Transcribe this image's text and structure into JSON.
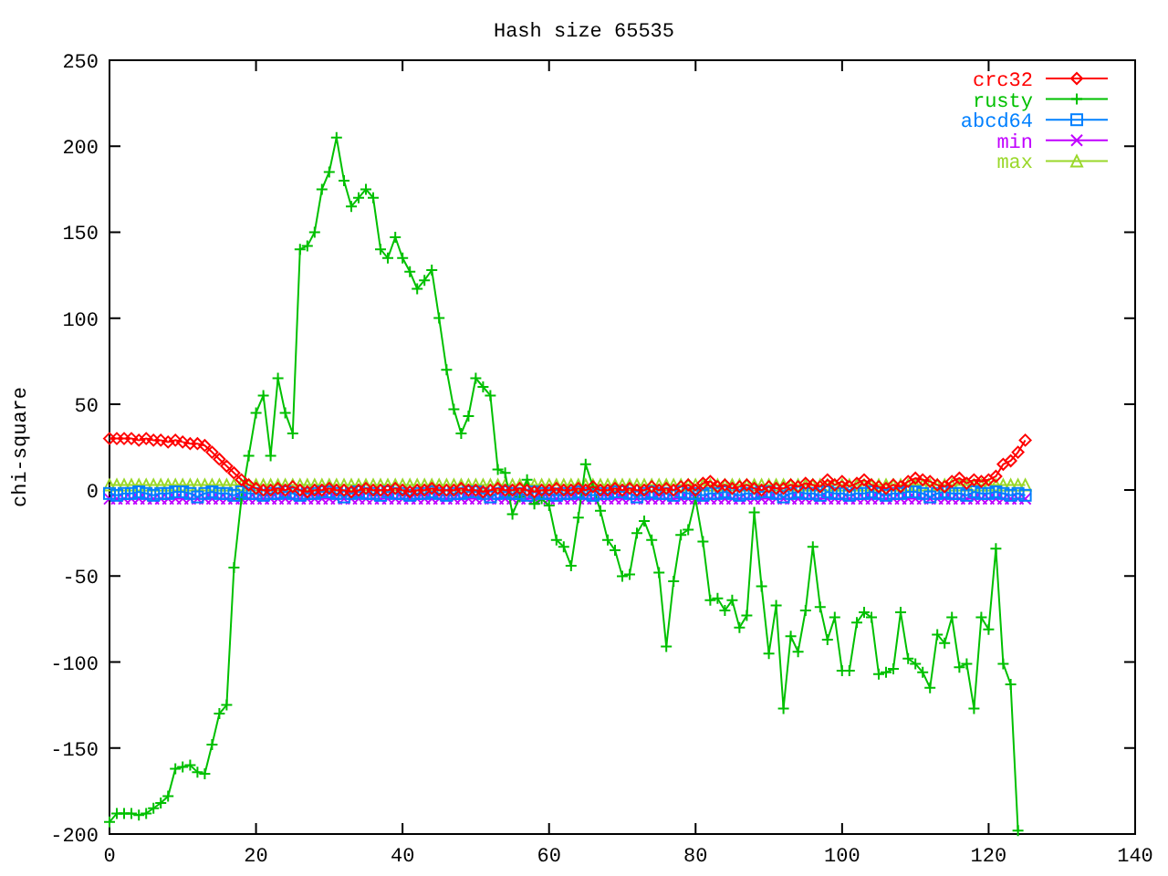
{
  "chart_data": {
    "type": "line",
    "title": "Hash size 65535",
    "ylabel": "chi-square",
    "x": [
      0,
      1,
      2,
      3,
      4,
      5,
      6,
      7,
      8,
      9,
      10,
      11,
      12,
      13,
      14,
      15,
      16,
      17,
      18,
      19,
      20,
      21,
      22,
      23,
      24,
      25,
      26,
      27,
      28,
      29,
      30,
      31,
      32,
      33,
      34,
      35,
      36,
      37,
      38,
      39,
      40,
      41,
      42,
      43,
      44,
      45,
      46,
      47,
      48,
      49,
      50,
      51,
      52,
      53,
      54,
      55,
      56,
      57,
      58,
      59,
      60,
      61,
      62,
      63,
      64,
      65,
      66,
      67,
      68,
      69,
      70,
      71,
      72,
      73,
      74,
      75,
      76,
      77,
      78,
      79,
      80,
      81,
      82,
      83,
      84,
      85,
      86,
      87,
      88,
      89,
      90,
      91,
      92,
      93,
      94,
      95,
      96,
      97,
      98,
      99,
      100,
      101,
      102,
      103,
      104,
      105,
      106,
      107,
      108,
      109,
      110,
      111,
      112,
      113,
      114,
      115,
      116,
      117,
      118,
      119,
      120,
      121,
      122,
      123,
      124,
      125
    ],
    "series": [
      {
        "name": "crc32",
        "color": "#ff0000",
        "marker": "diamond",
        "values": [
          30,
          30,
          30,
          30,
          29,
          30,
          29,
          29,
          28,
          29,
          28,
          27,
          27,
          26,
          22,
          18,
          14,
          10,
          6,
          3,
          1,
          0,
          0,
          1,
          0,
          2,
          0,
          -1,
          0,
          0,
          1,
          0,
          0,
          -1,
          0,
          1,
          0,
          0,
          0,
          1,
          0,
          -1,
          0,
          0,
          1,
          0,
          0,
          0,
          1,
          0,
          0,
          -1,
          0,
          1,
          0,
          0,
          1,
          0,
          -1,
          0,
          0,
          1,
          0,
          0,
          1,
          0,
          2,
          0,
          0,
          1,
          0,
          1,
          0,
          0,
          2,
          0,
          1,
          0,
          2,
          3,
          0,
          4,
          5,
          2,
          3,
          1,
          2,
          3,
          1,
          0,
          2,
          1,
          1,
          3,
          2,
          4,
          3,
          2,
          6,
          3,
          5,
          2,
          4,
          6,
          3,
          2,
          1,
          3,
          2,
          5,
          7,
          6,
          5,
          3,
          2,
          5,
          7,
          4,
          6,
          5,
          6,
          8,
          15,
          17,
          22,
          29
        ]
      },
      {
        "name": "rusty",
        "color": "#00c000",
        "marker": "plus",
        "values": [
          -193,
          -188,
          -188,
          -188,
          -189,
          -188,
          -185,
          -182,
          -178,
          -162,
          -161,
          -160,
          -164,
          -165,
          -148,
          -130,
          -125,
          -45,
          -5,
          20,
          45,
          55,
          20,
          65,
          45,
          33,
          140,
          142,
          150,
          175,
          185,
          205,
          180,
          165,
          170,
          175,
          170,
          140,
          135,
          147,
          135,
          127,
          117,
          122,
          128,
          100,
          70,
          47,
          33,
          43,
          65,
          60,
          55,
          12,
          10,
          -14,
          -4,
          6,
          -8,
          -5,
          -9,
          -29,
          -33,
          -44,
          -16,
          15,
          2,
          -12,
          -29,
          -35,
          -50,
          -49,
          -25,
          -18,
          -29,
          -48,
          -91,
          -53,
          -26,
          -23,
          -5,
          -30,
          -64,
          -63,
          -70,
          -64,
          -80,
          -73,
          -13,
          -56,
          -95,
          -67,
          -127,
          -85,
          -94,
          -70,
          -33,
          -68,
          -87,
          -74,
          -105,
          -105,
          -77,
          -71,
          -74,
          -107,
          -106,
          -104,
          -71,
          -98,
          -101,
          -106,
          -115,
          -84,
          -89,
          -74,
          -103,
          -101,
          -127,
          -74,
          -81,
          -34,
          -101,
          -113,
          -198,
          null
        ]
      },
      {
        "name": "abcd64",
        "color": "#0080ff",
        "marker": "square",
        "values": [
          -2,
          -3,
          -2,
          -2,
          -1,
          -2,
          -3,
          -2,
          -2,
          -1,
          -1,
          -2,
          -4,
          -2,
          -1,
          -2,
          -2,
          -3,
          -1,
          -2,
          -2,
          -3,
          -2,
          -2,
          -1,
          -2,
          -3,
          -2,
          -2,
          -1,
          -1,
          -2,
          -4,
          -2,
          -1,
          -2,
          -2,
          -3,
          -1,
          -2,
          -2,
          -3,
          -2,
          -2,
          -1,
          -2,
          -3,
          -2,
          -2,
          -1,
          -1,
          -2,
          -4,
          -2,
          -1,
          -2,
          -2,
          -3,
          -1,
          -2,
          -2,
          -3,
          -2,
          -2,
          -1,
          -2,
          -3,
          -2,
          -2,
          -1,
          -1,
          -2,
          -4,
          -2,
          -1,
          -2,
          -2,
          -3,
          -1,
          -2,
          -2,
          -3,
          -2,
          -2,
          -1,
          -2,
          -3,
          -2,
          -2,
          -1,
          -1,
          -2,
          -4,
          -2,
          -1,
          -2,
          -2,
          -3,
          -1,
          -2,
          -2,
          -3,
          -2,
          -2,
          -1,
          -2,
          -3,
          -2,
          -2,
          -1,
          -1,
          -2,
          -4,
          -2,
          -1,
          -2,
          -2,
          -3,
          -1,
          -2,
          -2,
          -1,
          -2,
          -3,
          -2,
          -3
        ]
      },
      {
        "name": "min",
        "color": "#c000ff",
        "marker": "cross",
        "values": [
          -5,
          -5,
          -5,
          -5,
          -5,
          -5,
          -5,
          -5,
          -5,
          -5,
          -5,
          -5,
          -5,
          -5,
          -5,
          -5,
          -5,
          -5,
          -5,
          -5,
          -5,
          -5,
          -5,
          -5,
          -5,
          -5,
          -5,
          -5,
          -5,
          -5,
          -5,
          -5,
          -5,
          -5,
          -5,
          -5,
          -5,
          -5,
          -5,
          -5,
          -5,
          -5,
          -5,
          -5,
          -5,
          -5,
          -5,
          -5,
          -5,
          -5,
          -5,
          -5,
          -5,
          -5,
          -5,
          -5,
          -5,
          -5,
          -5,
          -5,
          -5,
          -5,
          -5,
          -5,
          -5,
          -5,
          -5,
          -5,
          -5,
          -5,
          -5,
          -5,
          -5,
          -5,
          -5,
          -5,
          -5,
          -5,
          -5,
          -5,
          -5,
          -5,
          -5,
          -5,
          -5,
          -5,
          -5,
          -5,
          -5,
          -5,
          -5,
          -5,
          -5,
          -5,
          -5,
          -5,
          -5,
          -5,
          -5,
          -5,
          -5,
          -5,
          -5,
          -5,
          -5,
          -5,
          -5,
          -5,
          -5,
          -5,
          -5,
          -5,
          -5,
          -5,
          -5,
          -5,
          -5,
          -5,
          -5,
          -5,
          -5,
          -5,
          -5,
          -5,
          -5,
          -5
        ]
      },
      {
        "name": "max",
        "color": "#9ad82a",
        "marker": "triangle",
        "values": [
          3,
          3,
          3,
          3,
          3,
          3,
          3,
          3,
          3,
          3,
          3,
          3,
          3,
          3,
          3,
          3,
          3,
          3,
          3,
          3,
          3,
          3,
          3,
          3,
          3,
          3,
          3,
          3,
          3,
          3,
          3,
          3,
          3,
          3,
          3,
          3,
          3,
          3,
          3,
          3,
          3,
          3,
          3,
          3,
          3,
          3,
          3,
          3,
          3,
          3,
          3,
          3,
          3,
          3,
          3,
          3,
          3,
          3,
          3,
          3,
          3,
          3,
          3,
          3,
          3,
          3,
          3,
          3,
          3,
          3,
          3,
          3,
          3,
          3,
          3,
          3,
          3,
          3,
          3,
          3,
          3,
          3,
          3,
          3,
          3,
          3,
          3,
          3,
          3,
          3,
          3,
          3,
          3,
          3,
          3,
          3,
          3,
          3,
          3,
          3,
          3,
          3,
          3,
          3,
          3,
          3,
          3,
          3,
          3,
          3,
          3,
          3,
          3,
          3,
          3,
          3,
          3,
          3,
          3,
          3,
          3,
          3,
          3,
          3,
          3,
          3
        ]
      }
    ],
    "legend": true,
    "xlim": [
      0,
      140
    ],
    "ylim": [
      -200,
      250
    ],
    "xticks": [
      0,
      20,
      40,
      60,
      80,
      100,
      120,
      140
    ],
    "yticks": [
      -200,
      -150,
      -100,
      -50,
      0,
      50,
      100,
      150,
      200,
      250
    ]
  }
}
